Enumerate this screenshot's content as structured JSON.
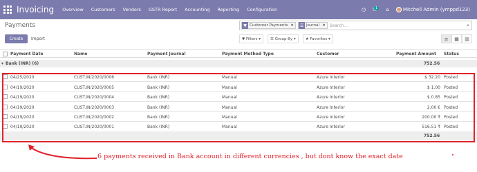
{
  "navbar": {
    "app_name": "Invoicing",
    "menu": [
      "Overview",
      "Customers",
      "Vendors",
      "GSTR Report",
      "Accounting",
      "Reporting",
      "Configuration"
    ],
    "message_count": "1",
    "user": "Mitchell Admin (ymppd123)"
  },
  "control": {
    "breadcrumb": "Payments",
    "create_label": "Create",
    "import_label": "Import",
    "search": {
      "facets": [
        {
          "icon": "filter-icon",
          "label": "Customer Payments"
        },
        {
          "icon": "group-icon",
          "label": "Journal"
        }
      ],
      "placeholder": "Search..."
    },
    "filters_label": "Filters",
    "groupby_label": "Group By",
    "favorites_label": "Favorites"
  },
  "table": {
    "headers": [
      "Payment Date",
      "Name",
      "Payment Journal",
      "Payment Method Type",
      "Customer",
      "Payment Amount",
      "Status"
    ],
    "group": {
      "label": "Bank (INR) (6)",
      "total": "752.56"
    },
    "rows": [
      {
        "date": "04/25/2020",
        "name": "CUST.IN/2020/0006",
        "journal": "Bank (INR)",
        "method": "Manual",
        "customer": "Azure Interior",
        "amount": "$ 32.20",
        "status": "Posted"
      },
      {
        "date": "04/19/2020",
        "name": "CUST.IN/2020/0005",
        "journal": "Bank (INR)",
        "method": "Manual",
        "customer": "Azure Interior",
        "amount": "$ 1.00",
        "status": "Posted"
      },
      {
        "date": "04/19/2020",
        "name": "CUST.IN/2020/0004",
        "journal": "Bank (INR)",
        "method": "Manual",
        "customer": "Azure Interior",
        "amount": "$ 0.85",
        "status": "Posted"
      },
      {
        "date": "04/19/2020",
        "name": "CUST.IN/2020/0003",
        "journal": "Bank (INR)",
        "method": "Manual",
        "customer": "Azure Interior",
        "amount": "2.00 €",
        "status": "Posted"
      },
      {
        "date": "04/19/2020",
        "name": "CUST.IN/2020/0002",
        "journal": "Bank (INR)",
        "method": "Manual",
        "customer": "Azure Interior",
        "amount": "200.00 ₹",
        "status": "Posted"
      },
      {
        "date": "04/19/2020",
        "name": "CUST.IN/2020/0001",
        "journal": "Bank (INR)",
        "method": "Manual",
        "customer": "Azure Interior",
        "amount": "516.51 ₹",
        "status": "Posted"
      }
    ],
    "footer_total": "752.56"
  },
  "annotation": {
    "text": "6 payments received in Bank account in different currencies , but dont know the exact date",
    "color": "#e0222b"
  },
  "colors": {
    "brand": "#7c7bad",
    "accent": "#00a09d"
  }
}
